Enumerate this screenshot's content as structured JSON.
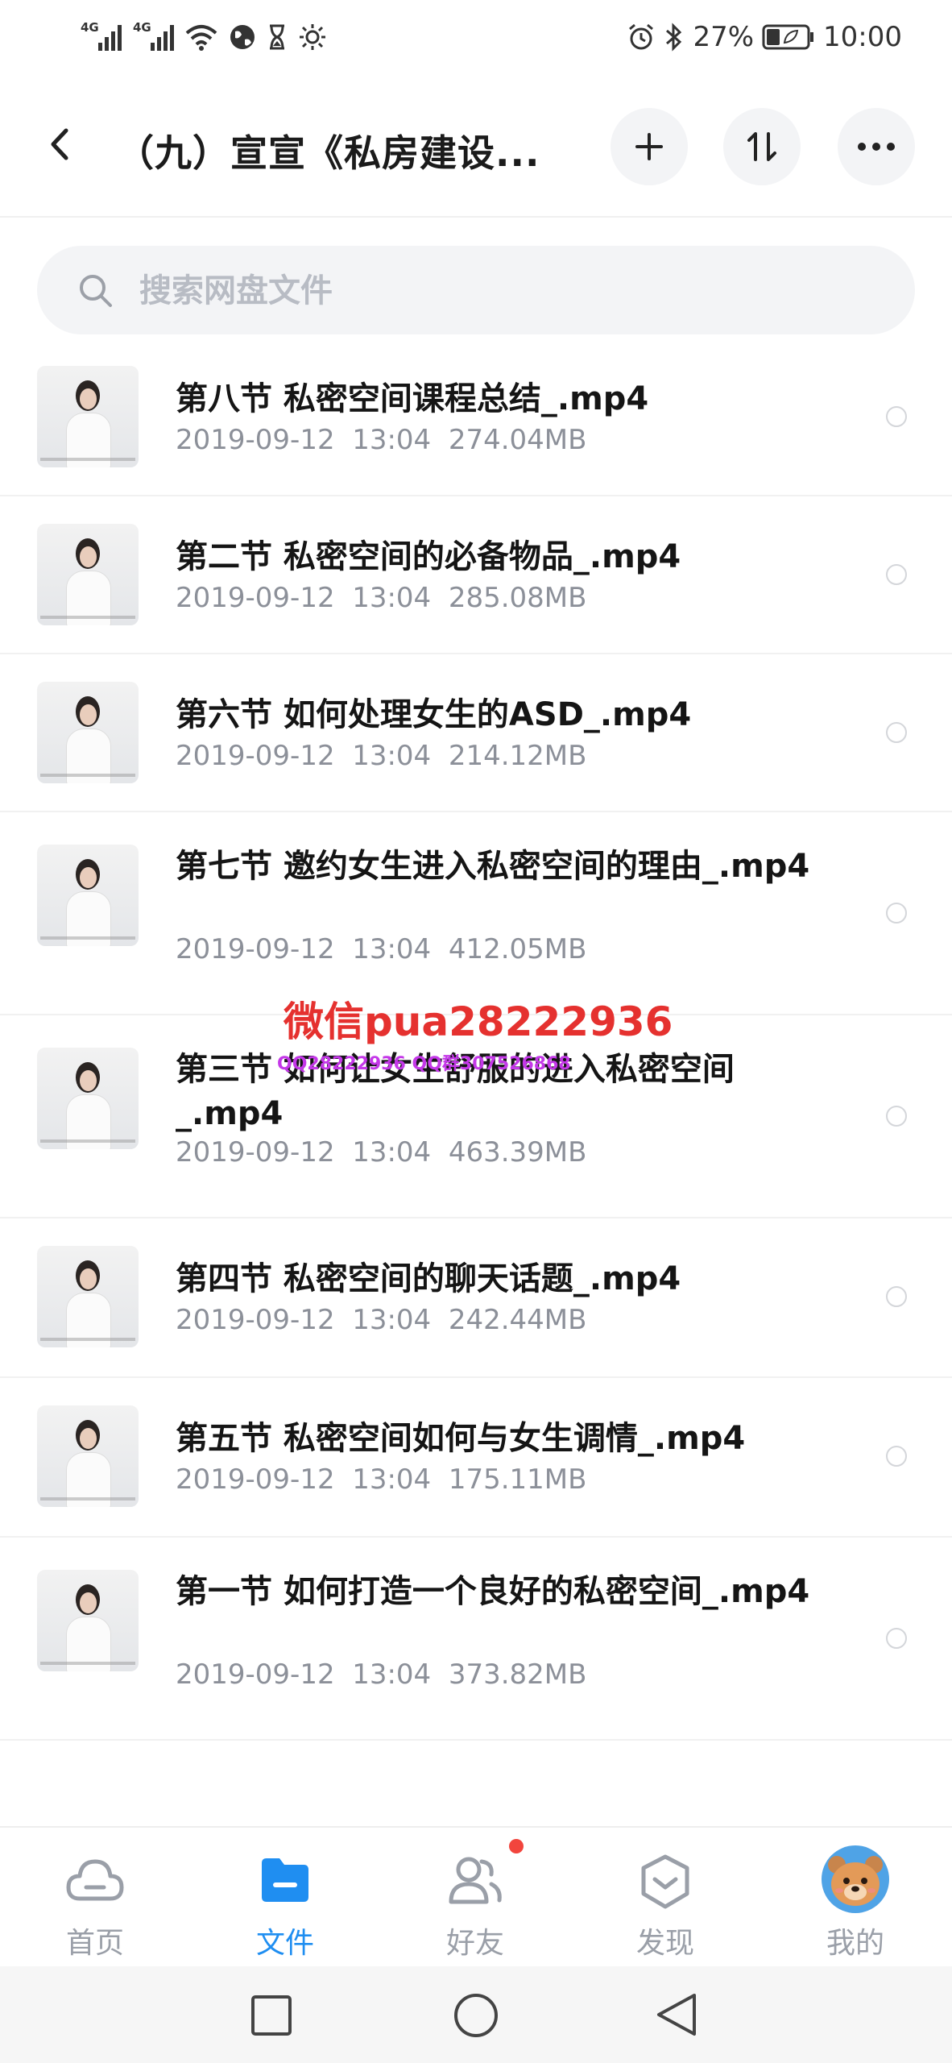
{
  "status_bar": {
    "network_tag_1": "4G",
    "network_tag_2": "4G",
    "battery_percent": "27%",
    "time": "10:00"
  },
  "header": {
    "title": "（九）宣宣《私房建设...",
    "icons": [
      "back-icon",
      "plus-icon",
      "sort-icon",
      "more-icon"
    ]
  },
  "search": {
    "placeholder": "搜索网盘文件"
  },
  "files": [
    {
      "name": "第八节  私密空间课程总结_.mp4",
      "date": "2019-09-12  13:04",
      "size": "274.04MB"
    },
    {
      "name": "第二节 私密空间的必备物品_.mp4",
      "date": "2019-09-12  13:04",
      "size": "285.08MB"
    },
    {
      "name": "第六节 如何处理女生的ASD_.mp4",
      "date": "2019-09-12  13:04",
      "size": "214.12MB"
    },
    {
      "name": "第七节 邀约女生进入私密空间的理由_.mp4",
      "date": "2019-09-12  13:04",
      "size": "412.05MB"
    },
    {
      "name": "第三节 如何让女生舒服的进入私密空间_.mp4",
      "date": "2019-09-12  13:04",
      "size": "463.39MB"
    },
    {
      "name": "第四节 私密空间的聊天话题_.mp4",
      "date": "2019-09-12  13:04",
      "size": "242.44MB"
    },
    {
      "name": "第五节 私密空间如何与女生调情_.mp4",
      "date": "2019-09-12  13:04",
      "size": "175.11MB"
    },
    {
      "name": "第一节  如何打造一个良好的私密空间_.mp4",
      "date": "2019-09-12  13:04",
      "size": "373.82MB"
    }
  ],
  "watermark": {
    "line1": "微信pua28222936",
    "line2": "QQ28222936 QQ群307526868"
  },
  "bottom_nav": [
    {
      "label": "首页",
      "icon": "cloud-icon"
    },
    {
      "label": "文件",
      "icon": "folder-icon",
      "active": true
    },
    {
      "label": "好友",
      "icon": "friends-icon"
    },
    {
      "label": "发现",
      "icon": "discover-icon"
    },
    {
      "label": "我的",
      "icon": "avatar-icon"
    }
  ],
  "colors": {
    "accent": "#1f8ef1",
    "badge": "#f2453d",
    "watermark_red": "#e5312f",
    "watermark_purple": "#c438e8"
  }
}
